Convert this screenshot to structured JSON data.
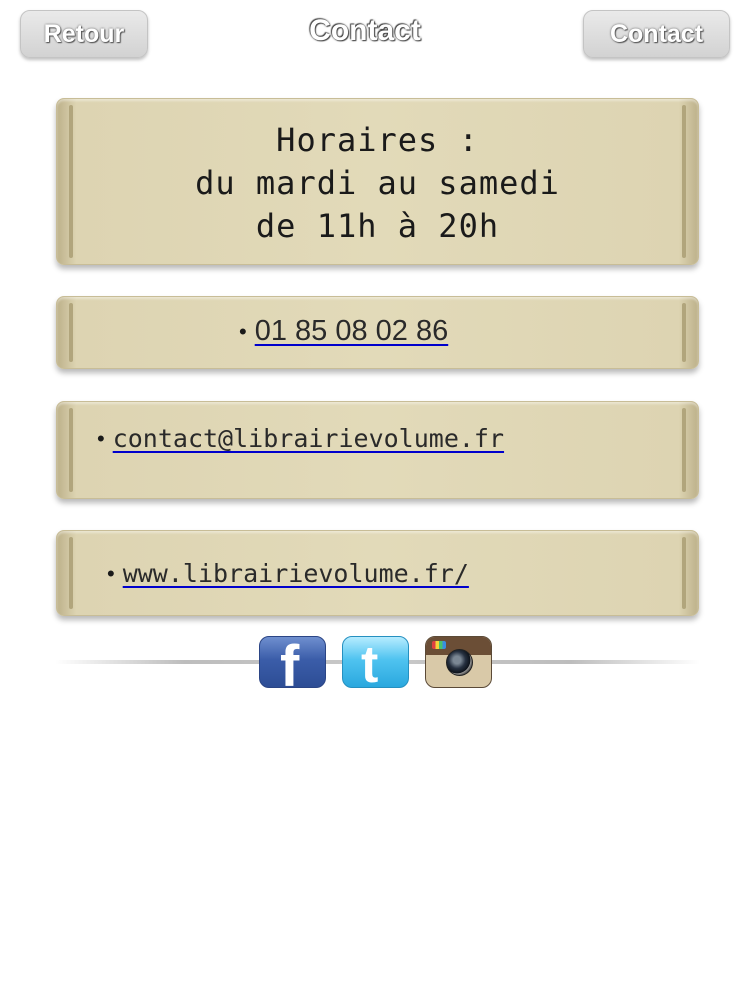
{
  "header": {
    "back_label": "Retour",
    "title": "Contact",
    "contact_label": "Contact"
  },
  "hours": {
    "line1": "Horaires :",
    "line2": "du mardi au samedi",
    "line3": "de 11h à 20h"
  },
  "contacts": {
    "bullet": "•",
    "phone": "01 85 08 02 86",
    "email": "contact@librairievolume.fr",
    "website": "www.librairievolume.fr/"
  },
  "social": {
    "facebook_glyph": "f",
    "twitter_glyph": "t",
    "icons": [
      "facebook-icon",
      "twitter-icon",
      "instagram-icon"
    ]
  },
  "colors": {
    "panel": "#e2dab9",
    "link_underline": "#0000cc",
    "facebook": "#3b5da9",
    "twitter": "#4fc3f0"
  }
}
